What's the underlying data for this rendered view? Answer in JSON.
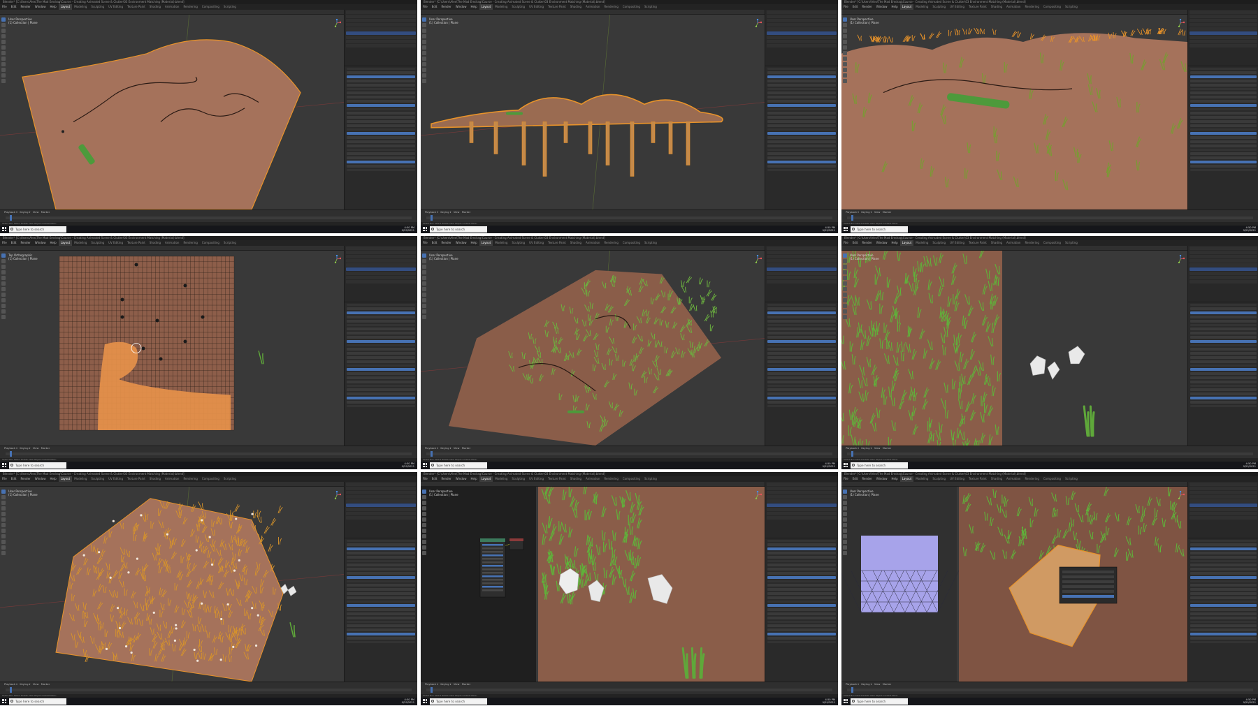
{
  "app": {
    "title": "Blender* [C:\\Users\\Alex\\The Mad Emdrag\\Course - Creating Animated Scene & Clutter\\03 Environment Matching (Material).blend]",
    "menus": [
      "File",
      "Edit",
      "Render",
      "Window",
      "Help"
    ],
    "workspaces": [
      "Layout",
      "Modeling",
      "Sculpting",
      "UV Editing",
      "Texture Paint",
      "Shading",
      "Animation",
      "Rendering",
      "Compositing",
      "Scripting"
    ],
    "active_workspace": "Layout"
  },
  "viewports": [
    {
      "label_line1": "User Perspective",
      "label_line2": "(1) Collection | Plane",
      "scene": "terrain-flat"
    },
    {
      "label_line1": "User Perspective",
      "label_line2": "(1) Collection | Plane",
      "scene": "terrain-side"
    },
    {
      "label_line1": "User Perspective",
      "label_line2": "(1) Collection | Plane",
      "scene": "terrain-grass-sparse"
    },
    {
      "label_line1": "Top Orthographic",
      "label_line2": "(1) Collection | Plane",
      "scene": "weight-paint-top"
    },
    {
      "label_line1": "User Perspective",
      "label_line2": "(1) Collection | Plane",
      "scene": "terrain-grass"
    },
    {
      "label_line1": "User Perspective",
      "label_line2": "(1) Collection | Plane",
      "scene": "grass-closeup-rocks"
    },
    {
      "label_line1": "User Perspective",
      "label_line2": "(1) Collection | Plane",
      "scene": "terrain-dense-orange"
    },
    {
      "label_line1": "User Perspective",
      "label_line2": "(1) Collection | Plane",
      "scene": "node-editor-rocks"
    },
    {
      "label_line1": "User Perspective",
      "label_line2": "(1) Collection | Plane",
      "scene": "uv-rock-closeup"
    }
  ],
  "timeline_menus": "Playback ▾   Keying ▾   View   Marker",
  "statusbar_text": "Select    Box Select    Rotate View    Object Context Menu",
  "taskbar": {
    "search_placeholder": "Type here to search",
    "time": "4:50 PM",
    "date": "9/29/2021"
  },
  "colors": {
    "terrain": "#a5725b",
    "terrain_dark": "#8a5d49",
    "selection_orange": "#e8932a",
    "grass": "#5fa83a",
    "grass_dark": "#3d7e28",
    "viewport_bg": "#393939",
    "accent_blue": "#4772b3"
  }
}
